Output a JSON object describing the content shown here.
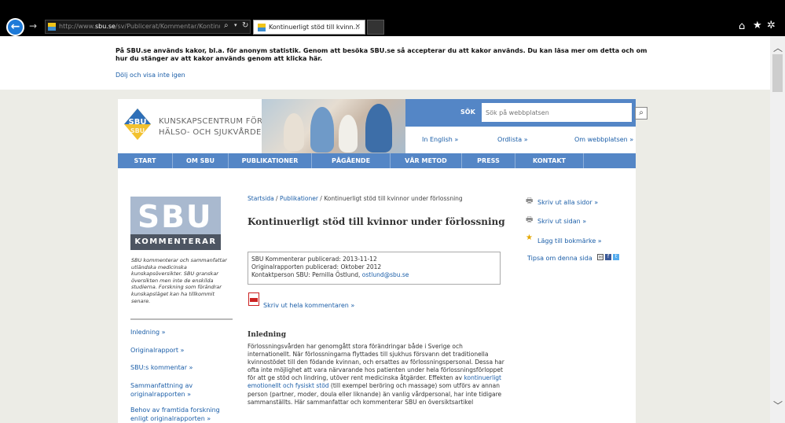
{
  "browser": {
    "url_prefix": "http://www.",
    "url_domain": "sbu.se",
    "url_rest": "/sv/Publicerat/Kommentar/Kontinu",
    "tab_title": "Kontinuerligt stöd till kvinn...",
    "tab_close": "×",
    "back_glyph": "←",
    "forward_glyph": "→",
    "icons": {
      "search": "search-icon",
      "refresh": "refresh-icon",
      "home": "home-icon",
      "favorites": "star-icon",
      "settings": "gear-icon"
    }
  },
  "cookie_banner": {
    "text": "På SBU.se används kakor, bl.a. för anonym statistik. Genom att besöka SBU.se så accepterar du att kakor används. Du kan läsa mer om detta och om hur du stänger av att kakor används genom att klicka här.",
    "hide_link": "Dölj och visa inte igen"
  },
  "header": {
    "logo_line1": "KUNSKAPSCENTRUM FÖR",
    "logo_line2": "HÄLSO- OCH SJUKVÅRDEN",
    "search_label": "SÖK",
    "search_placeholder": "Sök på webbplatsen",
    "util_links": [
      "In English »",
      "Ordlista »",
      "Om webbplatsen »"
    ]
  },
  "nav": [
    "START",
    "OM SBU",
    "PUBLIKATIONER",
    "PÅGÅENDE",
    "VÅR METOD",
    "PRESS",
    "KONTAKT"
  ],
  "left": {
    "sbu_letters": "SBU",
    "sbu_band": "KOMMENTERAR",
    "description": "SBU kommenterar och sammanfattar utländska medicinska kunskapsöversikter. SBU granskar översikten men inte de enskilda studierna. Forskning som förändrar kunskapsläget kan ha tillkommit senare.",
    "links": [
      "Inledning  »",
      "Originalrapport  »",
      "SBU:s kommentar »",
      "Sammanfattning av originalrapporten »",
      "Behov av framtida forskning enligt originalrapporten  »"
    ]
  },
  "main": {
    "breadcrumb_1": "Startsida",
    "breadcrumb_sep": " / ",
    "breadcrumb_2": "Publikationer",
    "breadcrumb_3": "Kontinuerligt stöd till kvinnor under förlossning",
    "title": "Kontinuerligt stöd till kvinnor under förlossning",
    "info_line1": "SBU Kommenterar publicerad: 2013-11-12",
    "info_line2": "Originalrapporten publicerad: Oktober 2012",
    "info_line3_prefix": "Kontaktperson SBU: Pernilla Östlund, ",
    "info_email": "ostlund@sbu.se",
    "pdf_link": "Skriv ut hela kommentaren »",
    "section_heading": "Inledning",
    "body_1": "Förlossningsvården har genomgått stora förändringar både i Sverige och internationellt. När förlossningarna flyttades till sjukhus försvann det traditionella kvinnostödet till den födande kvinnan, och ersattes av förlossningspersonal. Dessa har ofta inte möjlighet att vara närvarande hos patienten under hela förlossningsförloppet för att ge stöd och lindring, utöver rent medicinska åtgärder. Effekten av ",
    "body_link": "kontinuerligt emotionellt och fysiskt stöd",
    "body_2": " (till exempel beröring och massage) som utförs av annan person (partner, moder, doula eller liknande) än vanlig vårdpersonal, har inte tidigare sammanställts. Här sammanfattar och kommenterar SBU en översiktsartikel"
  },
  "right": {
    "print_all": "Skriv ut alla sidor »",
    "print_page": "Skriv ut sidan »",
    "bookmark": "Lägg till bokmärke »",
    "tipsa": "Tipsa om denna sida"
  },
  "colors": {
    "nav_blue": "#5486c6",
    "link_blue": "#1b5ea8",
    "page_bg": "#ecece6",
    "sbu_gray_blue": "#a9b9cf",
    "sbu_band": "#4d5562"
  }
}
